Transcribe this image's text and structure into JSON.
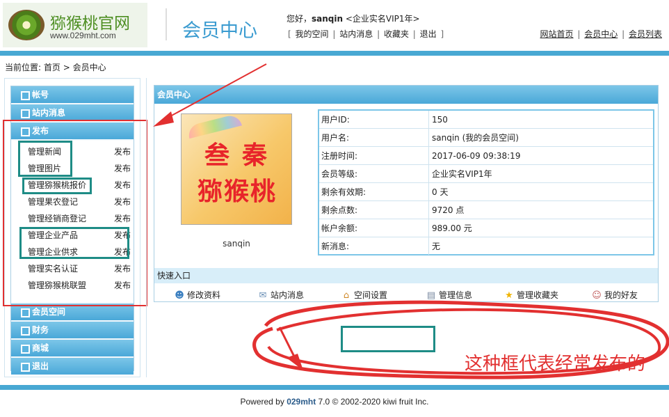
{
  "header": {
    "logo_cn": "猕猴桃官网",
    "logo_url": "www.029mht.com",
    "title": "会员中心",
    "greeting_prefix": "您好，",
    "username": "sanqin",
    "level_tag": " <企业实名VIP1年>",
    "user_links": [
      "我的空间",
      "站内消息",
      "收藏夹",
      "退出"
    ],
    "top_links": [
      "网站首页",
      "会员中心",
      "会员列表"
    ]
  },
  "breadcrumb": {
    "label": "当前位置:",
    "home": "首页",
    "arrow": ">",
    "current": "会员中心"
  },
  "sidebar": {
    "sections": [
      "帐号",
      "站内消息",
      "发布",
      "会员空间",
      "财务",
      "商城",
      "退出"
    ],
    "publish_items": [
      {
        "name": "管理新闻",
        "action": "发布"
      },
      {
        "name": "管理图片",
        "action": "发布"
      },
      {
        "name": "管理猕猴桃报价",
        "action": "发布"
      },
      {
        "name": "管理果农登记",
        "action": "发布"
      },
      {
        "name": "管理经销商登记",
        "action": "发布"
      },
      {
        "name": "管理企业产品",
        "action": "发布"
      },
      {
        "name": "管理企业供求",
        "action": "发布"
      },
      {
        "name": "管理实名认证",
        "action": "发布"
      },
      {
        "name": "管理猕猴桃联盟",
        "action": "发布"
      }
    ]
  },
  "panel": {
    "title": "会员中心",
    "avatar_text_line1": "叁秦",
    "avatar_text_line2": "猕猴桃",
    "avatar_name": "sanqin",
    "info": [
      {
        "label": "用户ID:",
        "value": "150"
      },
      {
        "label": "用户名:",
        "value": "sanqin  (我的会员空间)"
      },
      {
        "label": "注册时间:",
        "value": "2017-06-09 09:38:19"
      },
      {
        "label": "会员等级:",
        "value": "企业实名VIP1年"
      },
      {
        "label": "剩余有效期:",
        "value": "0 天"
      },
      {
        "label": "剩余点数:",
        "value": "9720 点"
      },
      {
        "label": "帐户余额:",
        "value": "989.00 元"
      },
      {
        "label": "新消息:",
        "value": "无"
      }
    ],
    "quick_title": "快速入口",
    "quick_links": [
      {
        "label": "修改资料",
        "icon": "user-edit-icon"
      },
      {
        "label": "站内消息",
        "icon": "mail-icon"
      },
      {
        "label": "空间设置",
        "icon": "home-icon"
      },
      {
        "label": "管理信息",
        "icon": "document-icon"
      },
      {
        "label": "管理收藏夹",
        "icon": "star-icon"
      },
      {
        "label": "我的好友",
        "icon": "friends-icon"
      }
    ]
  },
  "annotation": {
    "note": "这种框代表经常发布的"
  },
  "footer": {
    "prefix": "Powered by ",
    "brand": "029mht",
    "version": " 7.0",
    "copyright": "© 2002-2020 kiwi fruit Inc."
  },
  "colors": {
    "accent": "#48a8d3",
    "highlight": "#1e8c86",
    "annotation": "#e23030",
    "logo_green": "#4d8e22"
  }
}
